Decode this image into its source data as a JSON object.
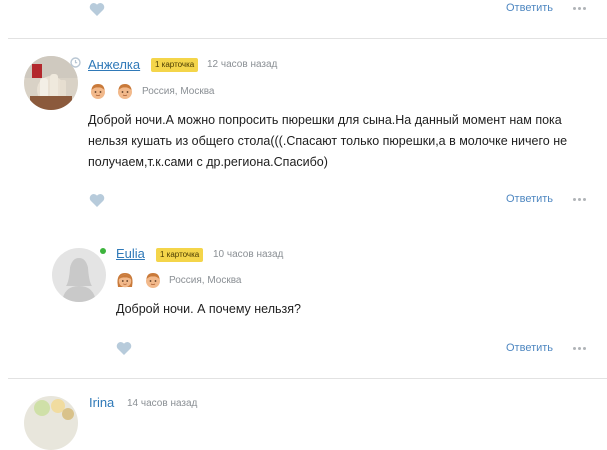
{
  "colors": {
    "accent": "#4e87c1",
    "name_link": "#2f79b8",
    "badge": "#f4d54a",
    "online": "#3db43d",
    "like_icon": "#b7cbdb"
  },
  "top_stub": {
    "reply_label": "Ответить"
  },
  "comments": [
    {
      "author": "Анжелка",
      "badge": "1 карточка",
      "time": "12 часов назад",
      "location": "Россия, Москва",
      "children_icons": [
        "boy-face-icon",
        "boy-face-icon"
      ],
      "text": "Доброй ночи.А можно попросить пюрешки для сына.На данный момент нам пока нельзя кушать из общего стола(((.Спасают только пюрешки,а в молочке ничего не получаем,т.к.сами с др.региона.Спасибо)",
      "reply_label": "Ответить"
    },
    {
      "author": "Eulia",
      "badge": "1 карточка",
      "time": "10 часов назад",
      "location": "Россия, Москва",
      "online": true,
      "children_icons": [
        "girl-face-icon",
        "boy-face-icon"
      ],
      "text": "Доброй ночи. А почему нельзя?",
      "reply_label": "Ответить"
    },
    {
      "author": "Irina",
      "time": "14 часов назад"
    }
  ]
}
